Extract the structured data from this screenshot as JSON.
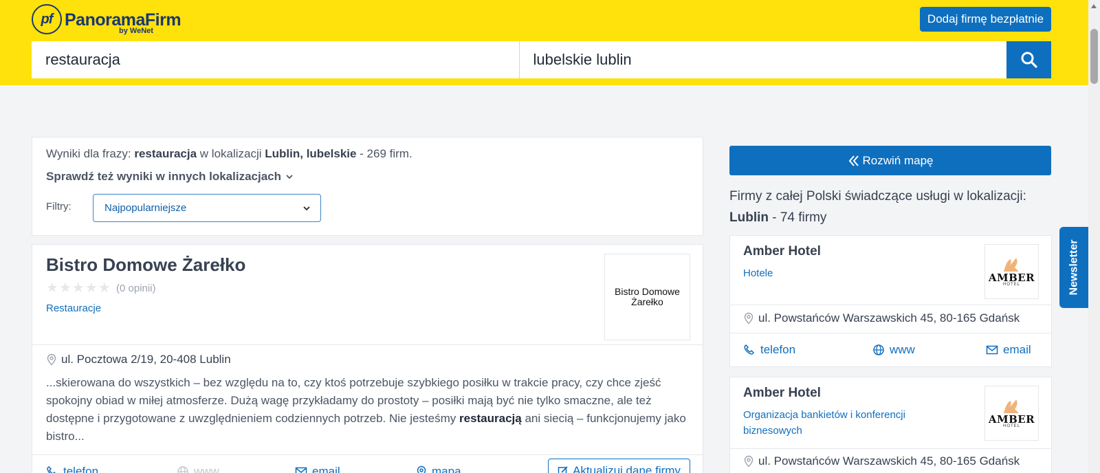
{
  "header": {
    "logo_mark": "pf",
    "logo_name": "PanoramaFirm",
    "logo_by": "by WeNet",
    "add_company_label": "Dodaj firmę bezpłatnie",
    "search_what_value": "restauracja",
    "search_where_value": "lubelskie lublin"
  },
  "summary": {
    "prefix": "Wyniki dla frazy: ",
    "phrase": "restauracja",
    "middle": " w lokalizacji ",
    "location": "Lublin, lubelskie",
    "count": " - 269 firm.",
    "other_locations": "Sprawdź też wyniki w innych lokalizacjach",
    "filters_label": "Filtry:",
    "filter_selected": "Najpopularniejsze"
  },
  "listing": {
    "name": "Bistro Domowe Żarełko",
    "rating_text": "(0 opinii)",
    "stars_filled": 0,
    "category": "Restauracje",
    "logo_line1": "Bistro Domowe",
    "logo_line2": "Żarełko",
    "address": "ul. Pocztowa 2/19, 20-408 Lublin",
    "desc_start": "...skierowana do wszystkich – bez względu na to, czy ktoś potrzebuje szybkiego posiłku w trakcie pracy, czy chce zjeść spokojny obiad w miłej atmosferze. Dużą wagę przykładamy do prostoty – posiłki mają być nie tylko smaczne, ale też dostępne i przygotowane z uwzględnieniem codziennych potrzeb. Nie jesteśmy ",
    "desc_bold": "restauracją",
    "desc_end": " ani siecią – funkcjonujemy jako bistro...",
    "actions": {
      "phone": "telefon",
      "www": "www",
      "email": "email",
      "map": "mapa",
      "update": "Aktualizuj dane firmy"
    }
  },
  "sidebar": {
    "map_button": "Rozwiń mapę",
    "poland_text": "Firmy z całej Polski świadczące usługi w lokalizacji:",
    "poland_location": "Lublin",
    "poland_count": " - 74 firmy",
    "cards": [
      {
        "name": "Amber Hotel",
        "category": "Hotele",
        "logo_word": "AMBER",
        "logo_sub": "HOTEL",
        "address": "ul. Powstańców Warszawskich 45, 80-165 Gdańsk",
        "phone": "telefon",
        "www": "www",
        "email": "email"
      },
      {
        "name": "Amber Hotel",
        "category": "Organizacja bankietów i konferencji biznesowych",
        "logo_word": "AMBER",
        "logo_sub": "HOTEL",
        "address": "ul. Powstańców Warszawskich 45, 80-165 Gdańsk"
      }
    ]
  },
  "newsletter_label": "Newsletter",
  "colors": {
    "header_yellow": "#ffe20c",
    "brand_blue": "#0f6fbf",
    "logo_navy": "#1b3770"
  }
}
